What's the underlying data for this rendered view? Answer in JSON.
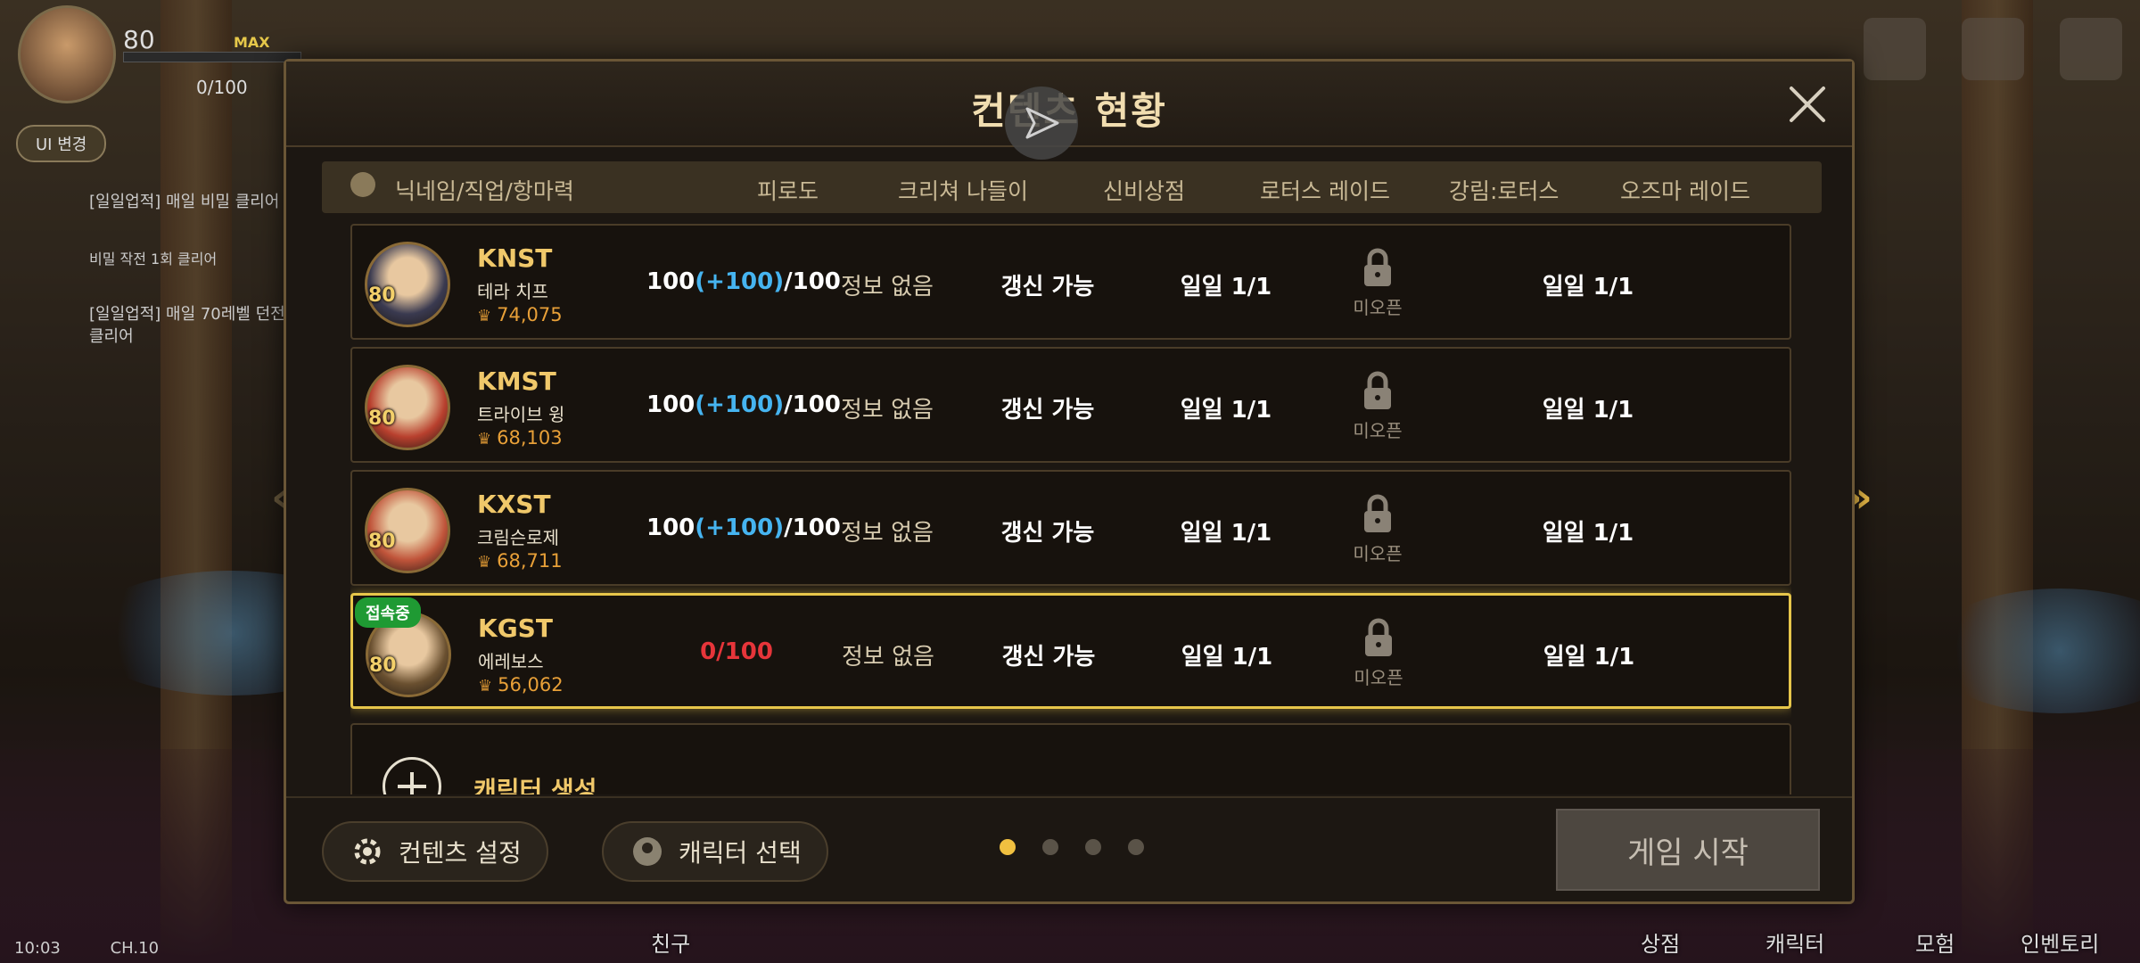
{
  "hud": {
    "level": "80",
    "max": "MAX",
    "stamina": "0/100",
    "chip": "UI 변경",
    "quests": [
      "[일일업적] 매일 비밀 클리어",
      "비밀 작전 1회 클리어",
      "[일일업적] 매일 70레벨 던전 클리어"
    ],
    "bottom": [
      "친구",
      "상점",
      "캐릭터",
      "모험",
      "인벤토리"
    ],
    "right_icons": [
      "이벤트",
      "우편함"
    ],
    "time": "10:03",
    "channel": "CH.10"
  },
  "modal": {
    "title": "컨텐츠 현황",
    "columns": [
      "닉네임/직업/항마력",
      "피로도",
      "크리쳐 나들이",
      "신비상점",
      "로터스 레이드",
      "강림:로터스",
      "오즈마 레이드"
    ],
    "characters": [
      {
        "name": "KNST",
        "job": "테라 치프",
        "power": "74,075",
        "level": "80",
        "fatigue_base": "100",
        "fatigue_bonus": "(+100)",
        "fatigue_max": "/100",
        "creature": "정보 없음",
        "mystic": "갱신 가능",
        "lotus": "일일 1/1",
        "descent": "미오픈",
        "ozma": "일일 1/1",
        "online": false,
        "portrait_color": "#3a3a50"
      },
      {
        "name": "KMST",
        "job": "트라이브 윙",
        "power": "68,103",
        "level": "80",
        "fatigue_base": "100",
        "fatigue_bonus": "(+100)",
        "fatigue_max": "/100",
        "creature": "정보 없음",
        "mystic": "갱신 가능",
        "lotus": "일일 1/1",
        "descent": "미오픈",
        "ozma": "일일 1/1",
        "online": false,
        "portrait_color": "#b8402e"
      },
      {
        "name": "KXST",
        "job": "크림슨로제",
        "power": "68,711",
        "level": "80",
        "fatigue_base": "100",
        "fatigue_bonus": "(+100)",
        "fatigue_max": "/100",
        "creature": "정보 없음",
        "mystic": "갱신 가능",
        "lotus": "일일 1/1",
        "descent": "미오픈",
        "ozma": "일일 1/1",
        "online": false,
        "portrait_color": "#c0543a"
      },
      {
        "name": "KGST",
        "job": "에레보스",
        "power": "56,062",
        "level": "80",
        "fatigue_base": "0/100",
        "fatigue_bonus": "",
        "fatigue_max": "",
        "creature": "정보 없음",
        "mystic": "갱신 가능",
        "lotus": "일일 1/1",
        "descent": "미오픈",
        "ozma": "일일 1/1",
        "online": true,
        "online_label": "접속중",
        "portrait_color": "#6a5030"
      }
    ],
    "create_label": "캐릭터 생성",
    "settings_button": "컨텐츠 설정",
    "select_button": "캐릭터 선택",
    "start_button": "게임 시작",
    "page_count": 4,
    "current_page": 1
  },
  "colors": {
    "accent_gold": "#f0c86a",
    "bonus_blue": "#46b4f0",
    "empty_red": "#e6353a",
    "online_green": "#1f9a33"
  }
}
